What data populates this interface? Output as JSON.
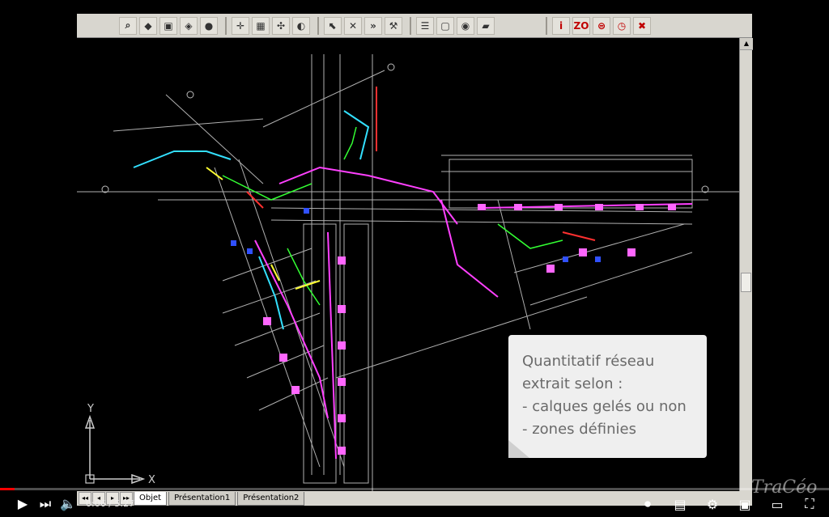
{
  "toolbar": {
    "buttons": [
      {
        "name": "zoom-tool-icon",
        "glyph": "⌕"
      },
      {
        "name": "layer-tool-icon",
        "glyph": "◆"
      },
      {
        "name": "view-tool-icon",
        "glyph": "▣"
      },
      {
        "name": "render-tool-icon",
        "glyph": "◈"
      },
      {
        "name": "globe-tool-icon",
        "glyph": "●"
      },
      {
        "name": "snap-tool-icon",
        "glyph": "✛"
      },
      {
        "name": "grid-tool-icon",
        "glyph": "▦"
      },
      {
        "name": "move-tool-icon",
        "glyph": "✣"
      },
      {
        "name": "circle-tool-icon",
        "glyph": "◐"
      },
      {
        "name": "select-tool-icon",
        "glyph": "⬉"
      },
      {
        "name": "delete-tool-icon",
        "glyph": "✕"
      },
      {
        "name": "forward-tool-icon",
        "glyph": "»"
      },
      {
        "name": "edit-tool-icon",
        "glyph": "⚒"
      },
      {
        "name": "table-tool-icon",
        "glyph": "☰"
      },
      {
        "name": "frame-tool-icon",
        "glyph": "▢"
      },
      {
        "name": "eye-tool-icon",
        "glyph": "◉"
      },
      {
        "name": "book-tool-icon",
        "glyph": "▰"
      }
    ],
    "right_buttons": [
      {
        "name": "info-tool-icon",
        "glyph": "i"
      },
      {
        "name": "zone-tool-icon",
        "glyph": "ZO"
      },
      {
        "name": "stack-tool-icon",
        "glyph": "⊜"
      },
      {
        "name": "gauge-tool-icon",
        "glyph": "◷"
      },
      {
        "name": "cross-tool-icon",
        "glyph": "✖"
      }
    ]
  },
  "tabs": {
    "nav": [
      "◂◂",
      "◂",
      "▸",
      "▸▸"
    ],
    "items": [
      {
        "label": "Objet",
        "active": true
      },
      {
        "label": "Présentation1",
        "active": false
      },
      {
        "label": "Présentation2",
        "active": false
      }
    ]
  },
  "axis": {
    "x_label": "X",
    "y_label": "Y"
  },
  "note": {
    "lines": [
      "Quantitatif réseau",
      "extrait selon :",
      "- calques gelés ou non",
      "- zones définies"
    ]
  },
  "player": {
    "time": "0:06 / 5:27",
    "progress": 0.018,
    "watermark": "TraCéo"
  },
  "colors": {
    "accent": "#ff0000",
    "note_bg": "#efefef"
  }
}
